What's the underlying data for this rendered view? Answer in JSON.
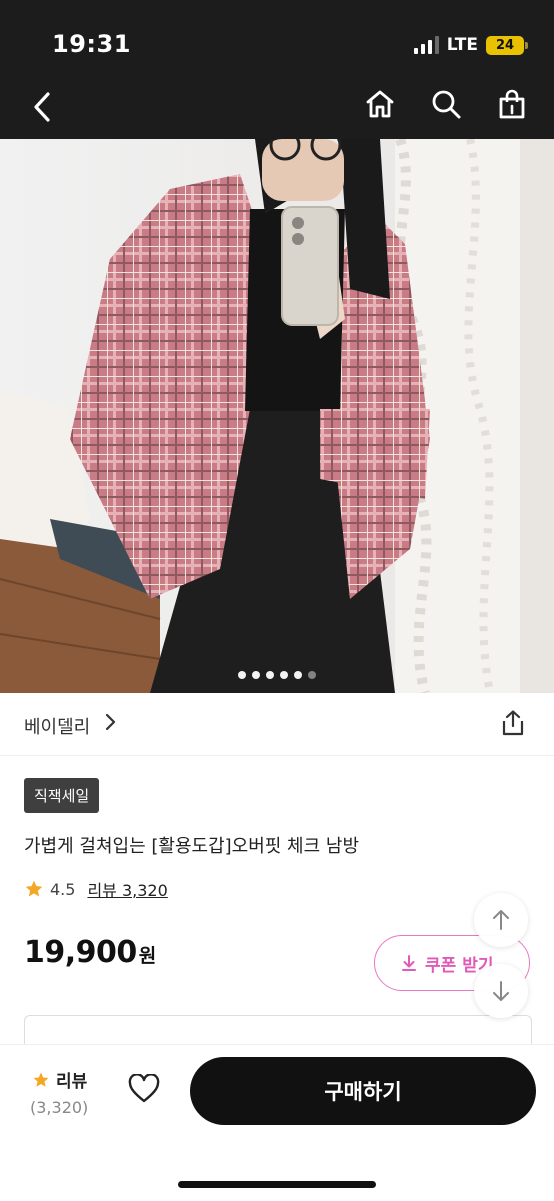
{
  "status": {
    "time": "19:31",
    "network": "LTE",
    "battery": "24"
  },
  "nav": {
    "back_icon": "chevron-left-icon",
    "home_icon": "home-icon",
    "search_icon": "search-icon",
    "cart_icon": "shopping-bag-icon"
  },
  "gallery": {
    "total_images": 6,
    "active_index": 0,
    "image": "photo of model wearing pink plaid overfit shirt"
  },
  "product": {
    "brand": "베이델리",
    "badge": "직잭세일",
    "title": "가볍게 걸쳐입는 [활용도갑]오버핏 체크 남방",
    "rating": "4.5",
    "review_label": "리뷰 3,320",
    "price": "19,900",
    "currency": "원",
    "coupon_label": "쿠폰 받기"
  },
  "bottom_bar": {
    "review_label": "리뷰",
    "review_count": "(3,320)",
    "buy_label": "구매하기"
  },
  "colors": {
    "accent_pink": "#e05bb8",
    "star": "#f5a623",
    "dark": "#111111"
  }
}
